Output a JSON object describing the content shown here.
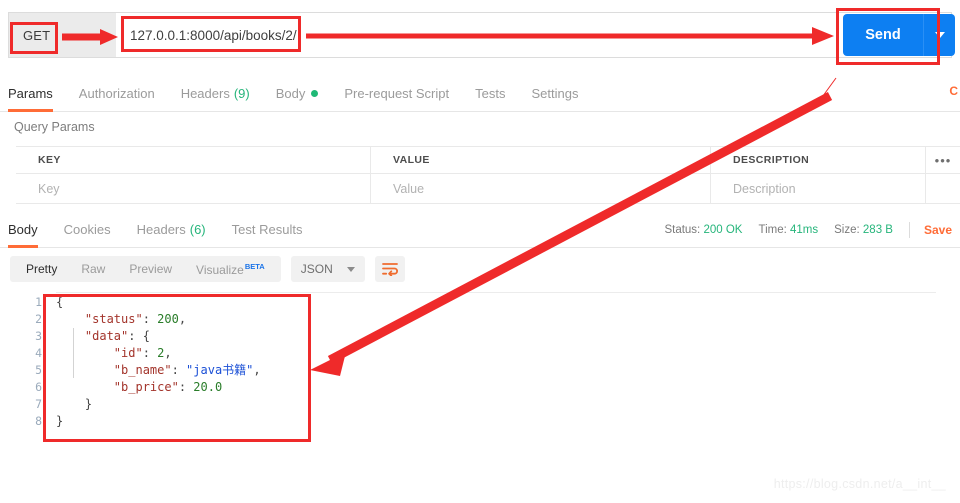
{
  "request": {
    "method": "GET",
    "url": "127.0.0.1:8000/api/books/2/",
    "send_label": "Send",
    "send_caret_icon": "chevron-down-icon",
    "tabs": [
      {
        "label": "Params",
        "active": true,
        "count": "",
        "dot": false
      },
      {
        "label": "Authorization",
        "active": false,
        "count": "",
        "dot": false
      },
      {
        "label": "Headers",
        "active": false,
        "count": "(9)",
        "dot": false
      },
      {
        "label": "Body",
        "active": false,
        "count": "",
        "dot": true
      },
      {
        "label": "Pre-request Script",
        "active": false,
        "count": "",
        "dot": false
      },
      {
        "label": "Tests",
        "active": false,
        "count": "",
        "dot": false
      },
      {
        "label": "Settings",
        "active": false,
        "count": "",
        "dot": false
      }
    ],
    "cookies_corner": "C"
  },
  "query_params": {
    "title": "Query Params",
    "headers": [
      "KEY",
      "VALUE",
      "DESCRIPTION"
    ],
    "more_icon": "ellipsis-icon",
    "row_placeholders": [
      "Key",
      "Value",
      "Description"
    ]
  },
  "response": {
    "tabs": [
      {
        "label": "Body",
        "active": true,
        "count": ""
      },
      {
        "label": "Cookies",
        "active": false,
        "count": ""
      },
      {
        "label": "Headers",
        "active": false,
        "count": "(6)"
      },
      {
        "label": "Test Results",
        "active": false,
        "count": ""
      }
    ],
    "status_label": "Status:",
    "status_value": "200 OK",
    "time_label": "Time:",
    "time_value": "41ms",
    "size_label": "Size:",
    "size_value": "283 B",
    "save_label": "Save",
    "view_modes": [
      {
        "label": "Pretty",
        "active": true,
        "beta": ""
      },
      {
        "label": "Raw",
        "active": false,
        "beta": ""
      },
      {
        "label": "Preview",
        "active": false,
        "beta": ""
      },
      {
        "label": "Visualize",
        "active": false,
        "beta": "BETA"
      }
    ],
    "format": "JSON",
    "format_caret_icon": "chevron-down-icon",
    "wrap_icon": "word-wrap-icon",
    "line_numbers": [
      "1",
      "2",
      "3",
      "4",
      "5",
      "6",
      "7",
      "8"
    ],
    "body_json": {
      "status": 200,
      "data": {
        "id": 2,
        "b_name": "java书籍",
        "b_price": 20.0
      }
    },
    "body_lines": [
      [
        {
          "t": "{",
          "c": "pun"
        }
      ],
      [
        {
          "t": "    ",
          "c": "pun"
        },
        {
          "t": "\"status\"",
          "c": "key"
        },
        {
          "t": ": ",
          "c": "pun"
        },
        {
          "t": "200",
          "c": "num"
        },
        {
          "t": ",",
          "c": "pun"
        }
      ],
      [
        {
          "t": "    ",
          "c": "pun"
        },
        {
          "t": "\"data\"",
          "c": "key"
        },
        {
          "t": ": {",
          "c": "pun"
        }
      ],
      [
        {
          "t": "        ",
          "c": "pun"
        },
        {
          "t": "\"id\"",
          "c": "key"
        },
        {
          "t": ": ",
          "c": "pun"
        },
        {
          "t": "2",
          "c": "num"
        },
        {
          "t": ",",
          "c": "pun"
        }
      ],
      [
        {
          "t": "        ",
          "c": "pun"
        },
        {
          "t": "\"b_name\"",
          "c": "key"
        },
        {
          "t": ": ",
          "c": "pun"
        },
        {
          "t": "\"java书籍\"",
          "c": "str"
        },
        {
          "t": ",",
          "c": "pun"
        }
      ],
      [
        {
          "t": "        ",
          "c": "pun"
        },
        {
          "t": "\"b_price\"",
          "c": "key"
        },
        {
          "t": ": ",
          "c": "pun"
        },
        {
          "t": "20.0",
          "c": "num"
        }
      ],
      [
        {
          "t": "    }",
          "c": "pun"
        }
      ],
      [
        {
          "t": "}",
          "c": "pun"
        }
      ]
    ]
  },
  "annotations": {
    "color": "#ef2a2a",
    "method_box": "highlight-method-box",
    "url_box": "highlight-url-box",
    "send_box": "highlight-send-box",
    "json_box": "highlight-json-box",
    "arrow_method_to_url": "arrow-right",
    "arrow_url_to_send": "arrow-right-long",
    "arrow_url_to_json": "arrow-diagonal"
  },
  "watermark": "https://blog.csdn.net/a__int__"
}
